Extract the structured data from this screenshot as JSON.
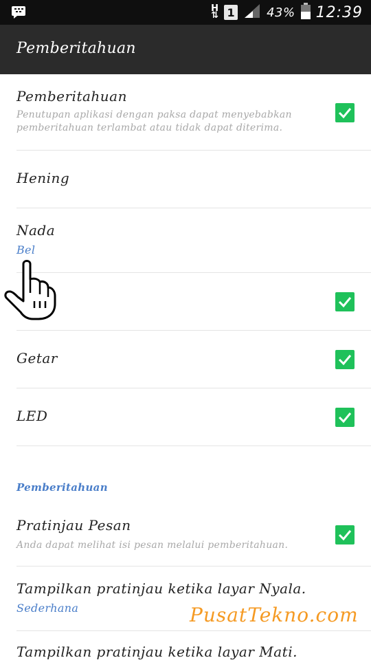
{
  "status_bar": {
    "notification_icon": "bbm-chat-icon",
    "network_type": "H",
    "sim_slot": "1",
    "battery_percent": "43%",
    "time": "12:39"
  },
  "app_bar": {
    "title": "Pemberitahuan"
  },
  "settings": [
    {
      "title": "Pemberitahuan",
      "summary": "Penutupan aplikasi dengan paksa dapat menyebabkan pemberitahuan terlambat atau tidak dapat diterima.",
      "checked": true
    },
    {
      "title": "Hening"
    },
    {
      "title": "Nada",
      "value": "Bel"
    },
    {
      "title": "",
      "checked": true
    },
    {
      "title": "Getar",
      "checked": true
    },
    {
      "title": "LED",
      "checked": true
    }
  ],
  "section_header": "Pemberitahuan",
  "section_settings": [
    {
      "title": "Pratinjau Pesan",
      "summary": "Anda dapat melihat isi pesan melalui pemberitahuan.",
      "checked": true
    },
    {
      "title": "Tampilkan pratinjau ketika layar Nyala.",
      "value": "Sederhana"
    },
    {
      "title": "Tampilkan pratinjau ketika layar Mati."
    }
  ],
  "overlay": {
    "pointer_icon": "hand-pointer-icon",
    "watermark": "PusatTekno.com"
  },
  "colors": {
    "accent": "#4a7ec9",
    "checkbox": "#1fc15a",
    "app_bar": "#2b2b2b",
    "watermark": "#f59a23"
  }
}
